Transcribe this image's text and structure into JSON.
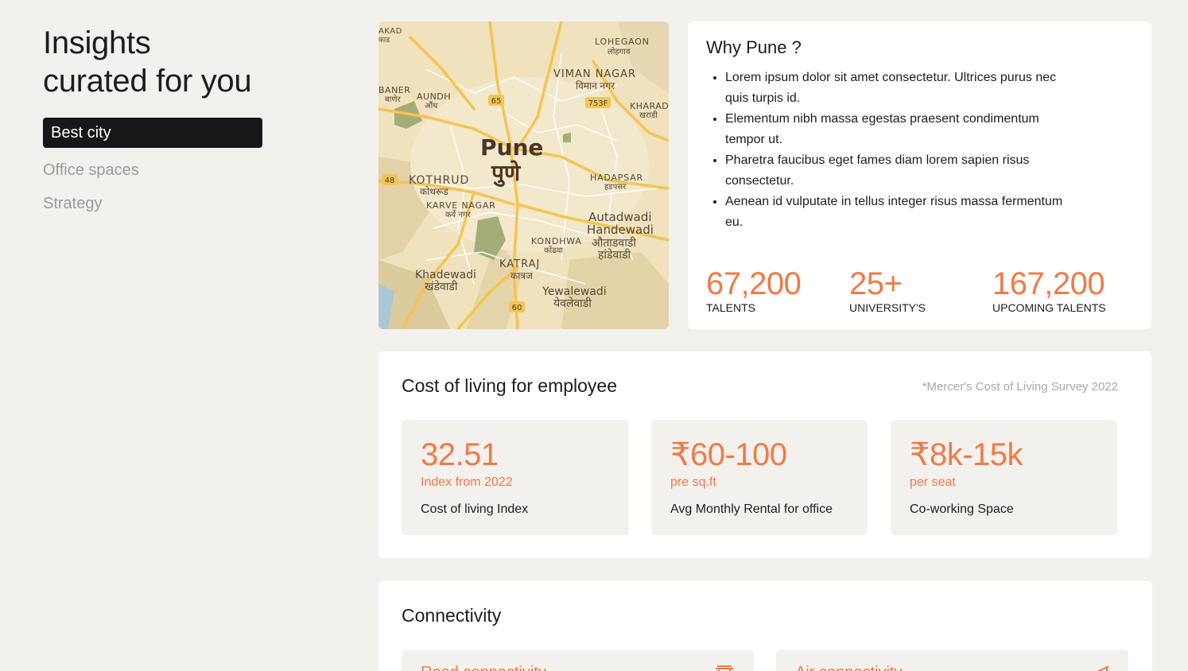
{
  "sidebar": {
    "title_line1": "Insights",
    "title_line2": "curated for you",
    "nav": [
      {
        "label": "Best city",
        "active": true
      },
      {
        "label": "Office spaces",
        "active": false
      },
      {
        "label": "Strategy",
        "active": false
      }
    ]
  },
  "map": {
    "city": "Pune",
    "city_local": "पुणे",
    "labels": {
      "akad": "AKAD",
      "akad_local": "काड",
      "lohegaon": "LOHEGAON",
      "lohegaon_local": "लोहगाव",
      "viman_nagar": "VIMAN NAGAR",
      "viman_nagar_local": "विमान नगर",
      "baner": "BANER",
      "baner_local": "बाणेर",
      "aundh": "AUNDH",
      "aundh_local": "औंध",
      "kharadi": "KHARAD",
      "kharadi_local": "खराडी",
      "kothrud": "KOTHRUD",
      "kothrud_local": "कोथरूड",
      "karve_nagar": "KARVE NAGAR",
      "karve_nagar_local": "कर्वे नगर",
      "hadapsar": "HADAPSAR",
      "hadapsar_local": "हडपसर",
      "autadwadi": "Autadwadi",
      "handewadi": "Handewadi",
      "autadwadi_local": "औताडवाडी",
      "handewadi_local": "हांडेवाडी",
      "kondhwa": "KONDHWA",
      "kondhwa_local": "कोंढवा",
      "katraj": "KATRAJ",
      "katraj_local": "कात्रज",
      "khadewadi": "Khadewadi",
      "khadewadi_local": "खंडेवाडी",
      "yewalewadi": "Yewalewadi",
      "yewalewadi_local": "येवलेवाडी"
    },
    "shields": [
      "65",
      "753F",
      "48",
      "60"
    ]
  },
  "why": {
    "title": "Why Pune ?",
    "bullets": [
      "Lorem ipsum dolor sit amet consectetur. Ultrices purus nec quis turpis id.",
      "Elementum nibh massa egestas praesent condimentum tempor ut.",
      "Pharetra faucibus eget fames diam lorem sapien risus consectetur.",
      "Aenean id vulputate in tellus integer risus massa fermentum eu."
    ],
    "stats": [
      {
        "value": "67,200",
        "label": "TALENTS"
      },
      {
        "value": "25+",
        "label": "UNIVERSITY'S"
      },
      {
        "value": "167,200",
        "label": "UPCOMING TALENTS"
      }
    ]
  },
  "cost": {
    "title": "Cost of living for employee",
    "source": "*Mercer's Cost of Living Survey 2022",
    "tiles": [
      {
        "value": "32.51",
        "sub": "Index from 2022",
        "desc": "Cost of living Index"
      },
      {
        "value": "₹60-100",
        "sub": "pre sq.ft",
        "desc": "Avg Monthly Rental for office"
      },
      {
        "value": "₹8k-15k",
        "sub": "per seat",
        "desc": "Co-working Space"
      }
    ]
  },
  "connectivity": {
    "title": "Connectivity",
    "tiles": [
      {
        "label": "Road connectivity",
        "icon": "train-icon"
      },
      {
        "label": "Air connectivity",
        "icon": "plane-icon"
      }
    ]
  },
  "colors": {
    "accent": "#f07a45",
    "background": "#f3f1ed",
    "active_nav": "#17171a"
  }
}
